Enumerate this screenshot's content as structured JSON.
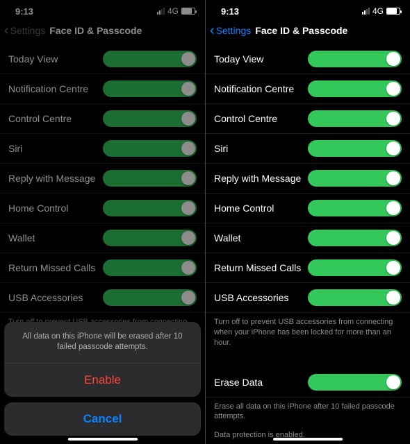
{
  "status": {
    "time": "9:13",
    "carrier": "4G"
  },
  "nav": {
    "back": "Settings",
    "title": "Face ID & Passcode"
  },
  "rows": {
    "today_view": "Today View",
    "notification_centre": "Notification Centre",
    "control_centre": "Control Centre",
    "siri": "Siri",
    "reply_with_message": "Reply with Message",
    "home_control": "Home Control",
    "wallet": "Wallet",
    "return_missed_calls": "Return Missed Calls",
    "usb_accessories": "USB Accessories",
    "erase_data": "Erase Data"
  },
  "footnotes": {
    "usb": "Turn off to prevent USB accessories from connecting when your iPhone has been locked for more than an hour.",
    "erase": "Erase all data on this iPhone after 10 failed passcode attempts.",
    "protection": "Data protection is enabled."
  },
  "sheet": {
    "message": "All data on this iPhone will be erased after 10 failed passcode attempts.",
    "enable": "Enable",
    "cancel": "Cancel"
  }
}
